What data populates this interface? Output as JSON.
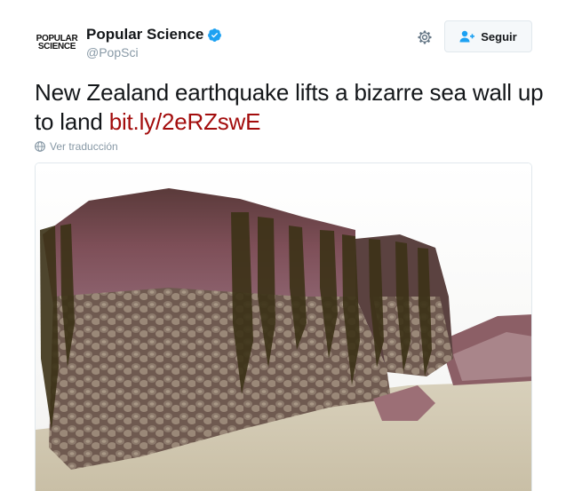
{
  "author": {
    "avatar_lines": [
      "POPULAR",
      "SCIENCE"
    ],
    "name": "Popular Science",
    "handle": "@PopSci",
    "verified": true
  },
  "actions": {
    "follow_label": "Seguir",
    "settings_icon": "gear-icon",
    "follow_icon": "add-person-icon"
  },
  "tweet": {
    "text": "New Zealand earthquake lifts a bizarre sea wall up to land ",
    "link": "bit.ly/2eRZswE",
    "translate_label": "Ver traducción",
    "translate_icon": "globe-icon"
  },
  "colors": {
    "link": "#a30d0d",
    "verified": "#1da1f2",
    "follow_icon": "#1da1f2",
    "muted": "#8899a6"
  }
}
